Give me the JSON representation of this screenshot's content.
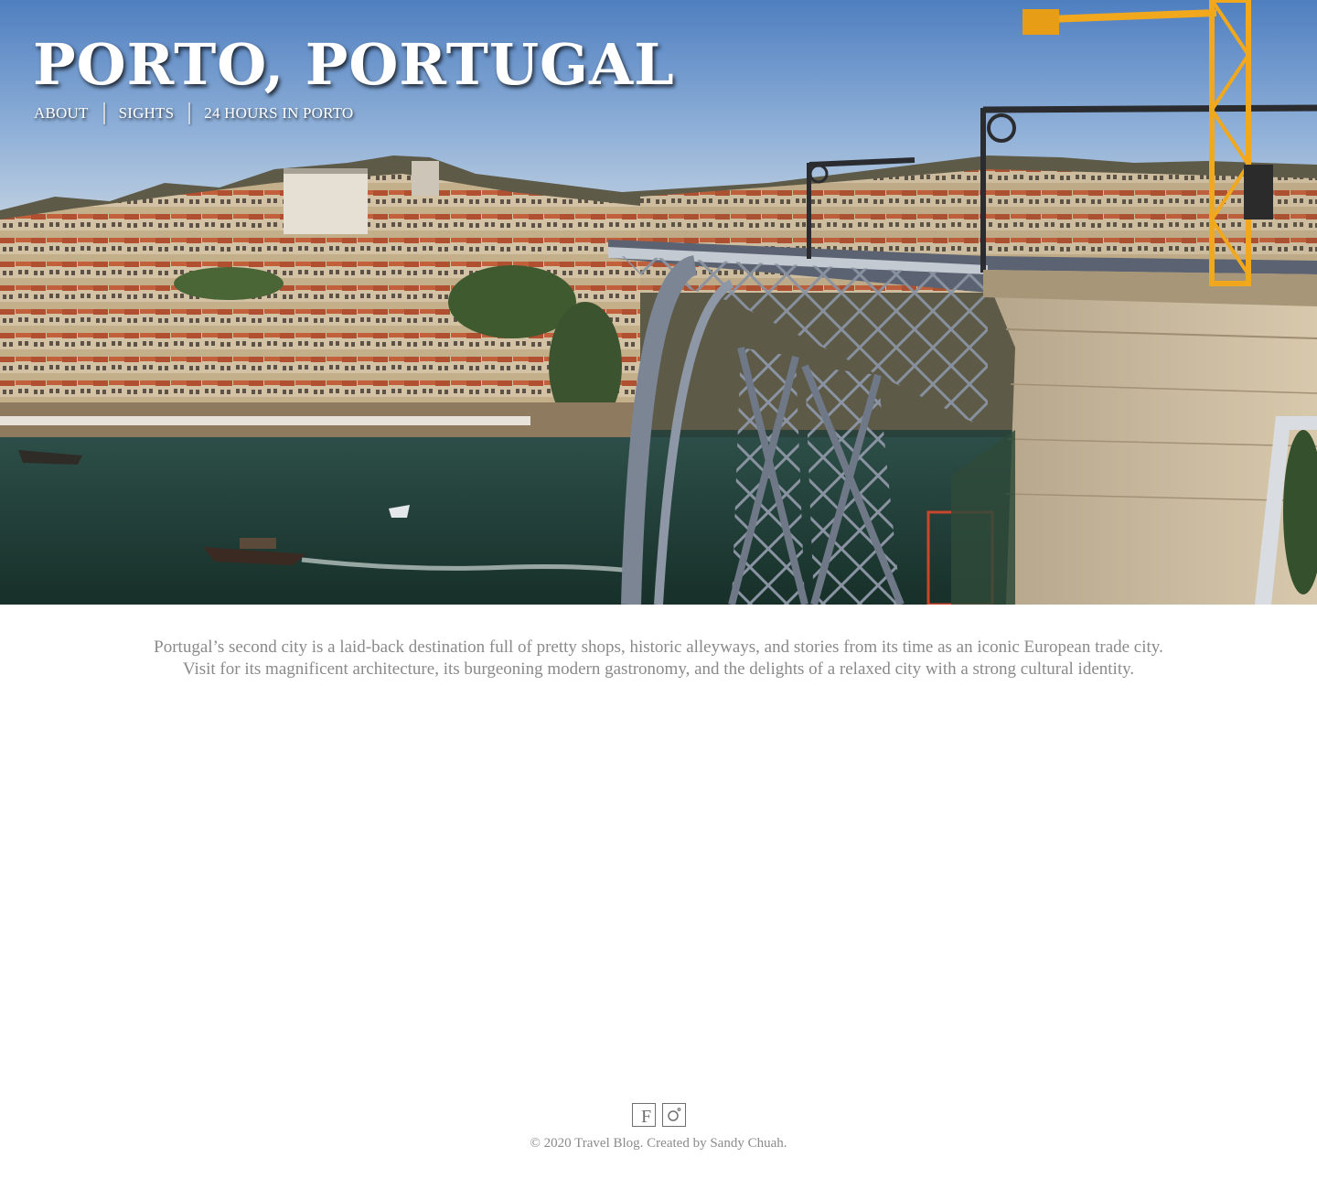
{
  "header": {
    "title": "PORTO, PORTUGAL",
    "nav": [
      {
        "label": "ABOUT"
      },
      {
        "label": "SIGHTS"
      },
      {
        "label": "24 HOURS IN PORTO"
      }
    ]
  },
  "hero": {
    "image_icon": "porto-bridge-photo",
    "colors": {
      "sky": "#5b86c2",
      "river": "#1f3d38",
      "bridge": "#6e7888",
      "crane": "#f2a81c"
    }
  },
  "main": {
    "intro": "Portugal’s second city is a laid-back destination full of pretty shops, historic alleyways, and stories from its time as an iconic European trade city. Visit for its magnificent architecture, its burgeoning modern gastronomy, and the delights of a relaxed city with a strong cultural identity."
  },
  "footer": {
    "social": [
      {
        "icon": "facebook-icon",
        "glyph": "F"
      },
      {
        "icon": "instagram-icon"
      }
    ],
    "copyright": "© 2020 Travel Blog.  Created by Sandy Chuah."
  }
}
